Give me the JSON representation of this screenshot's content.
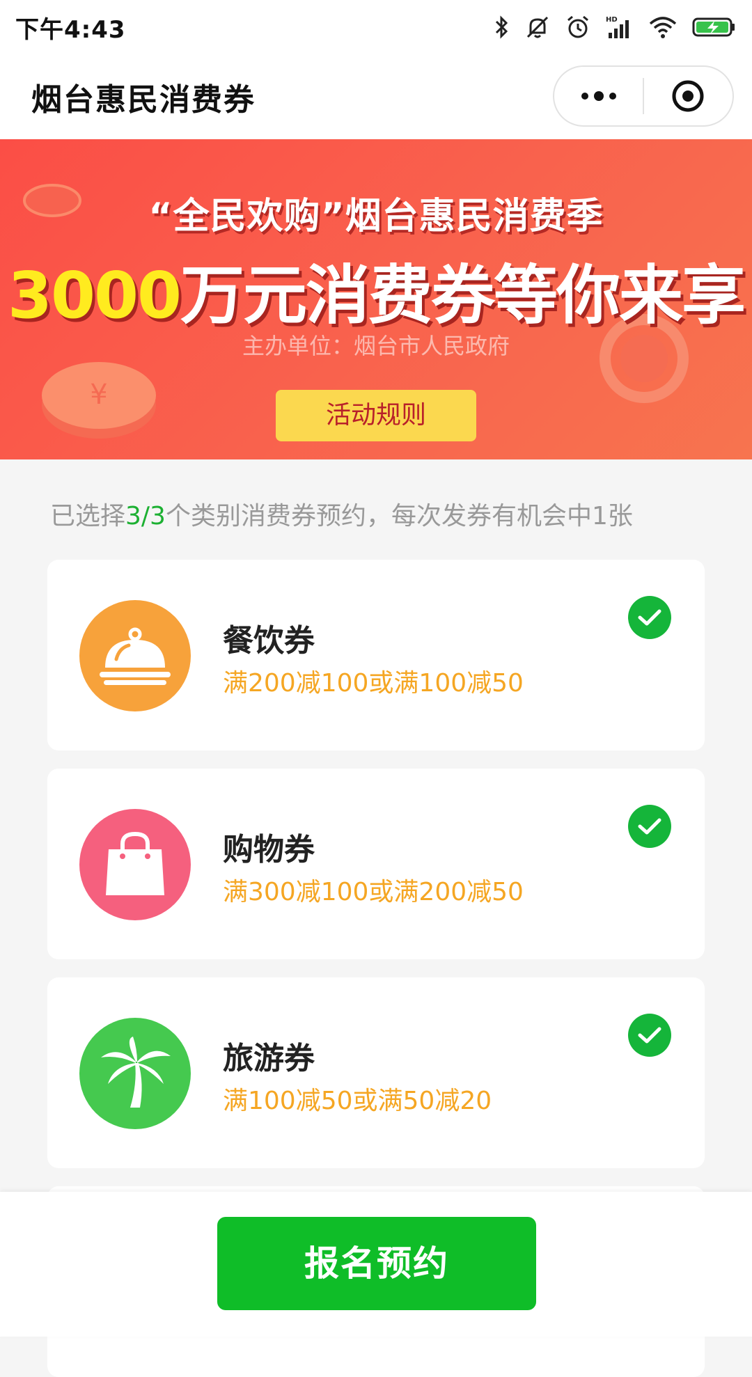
{
  "status_bar": {
    "time": "下午4:43",
    "icons": [
      "bluetooth-icon",
      "mute-icon",
      "alarm-icon",
      "hd-signal-icon",
      "wifi-icon",
      "battery-charging-icon"
    ],
    "signal_label": "HD"
  },
  "nav": {
    "title": "烟台惠民消费券",
    "more_icon": "more-dots-icon",
    "close_icon": "target-close-icon"
  },
  "banner": {
    "line1": "“全民欢购”烟台惠民消费季",
    "line2_highlight": "3000",
    "line2_rest": "万元消费券等你来享",
    "organizer": "主办单位：烟台市人民政府",
    "rules_button": "活动规则",
    "colors": {
      "start": "#fb4e46",
      "end": "#f7744f",
      "highlight": "#ffeb1f",
      "button": "#fbd84f"
    }
  },
  "hint": {
    "prefix": "已选择",
    "count": "3/3",
    "suffix": "个类别消费券预约，每次发券有机会中1张"
  },
  "coupons": [
    {
      "title": "餐饮券",
      "desc": "满200减100或满100减50",
      "icon": "food-cloche-icon",
      "color": "#f7a23b",
      "selected": true
    },
    {
      "title": "购物券",
      "desc": "满300减100或满200减50",
      "icon": "shopping-bag-icon",
      "color": "#f5607e",
      "selected": true
    },
    {
      "title": "旅游券",
      "desc": "满100减50或满50减20",
      "icon": "palm-tree-icon",
      "color": "#45c94f",
      "selected": true
    }
  ],
  "submit_button": "报名预约",
  "accent_colors": {
    "check": "#15b53a",
    "submit": "#0fbd28",
    "desc": "#f5a623"
  }
}
